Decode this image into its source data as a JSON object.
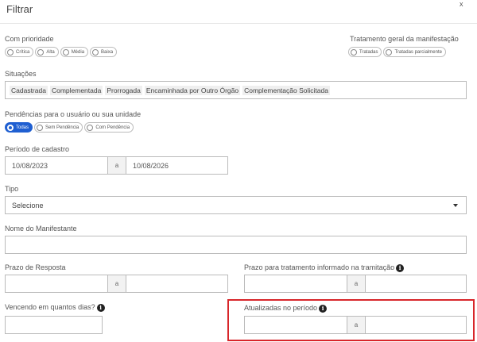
{
  "modal": {
    "title": "Filtrar",
    "close_label": "x"
  },
  "com_prioridade": {
    "label": "Com prioridade",
    "options": [
      {
        "label": "Crítica",
        "selected": false
      },
      {
        "label": "Alta",
        "selected": false
      },
      {
        "label": "Média",
        "selected": false
      },
      {
        "label": "Baixa",
        "selected": false
      }
    ]
  },
  "tratamento": {
    "label": "Tratamento geral da manifestação",
    "options": [
      {
        "label": "Tratadas",
        "selected": false
      },
      {
        "label": "Tratadas parcialmente",
        "selected": false
      }
    ]
  },
  "situacoes": {
    "label": "Situações",
    "tags": [
      "Cadastrada",
      "Complementada",
      "Prorrogada",
      "Encaminhada por Outro Órgão",
      "Complementação Solicitada"
    ]
  },
  "pendencias": {
    "label": "Pendências para o usuário ou sua unidade",
    "options": [
      {
        "label": "Todas",
        "selected": true
      },
      {
        "label": "Sem Pendência",
        "selected": false
      },
      {
        "label": "Com Pendência",
        "selected": false
      }
    ]
  },
  "periodo_cadastro": {
    "label": "Período de cadastro",
    "from": "10/08/2023",
    "separator": "a",
    "to": "10/08/2026"
  },
  "tipo": {
    "label": "Tipo",
    "selected": "Selecione"
  },
  "nome_manifestante": {
    "label": "Nome do Manifestante",
    "value": ""
  },
  "prazo_resposta": {
    "label": "Prazo de Resposta",
    "separator": "a",
    "from": "",
    "to": ""
  },
  "prazo_tratamento": {
    "label": "Prazo para tratamento informado na tramitação",
    "separator": "a",
    "from": "",
    "to": ""
  },
  "vencendo": {
    "label": "Vencendo em quantos dias?",
    "value": ""
  },
  "atualizadas": {
    "label": "Atualizadas no período",
    "separator": "a",
    "from": "",
    "to": ""
  },
  "icons": {
    "info": "i"
  },
  "colors": {
    "accent": "#1f5fd1",
    "highlight": "#d8262a"
  }
}
